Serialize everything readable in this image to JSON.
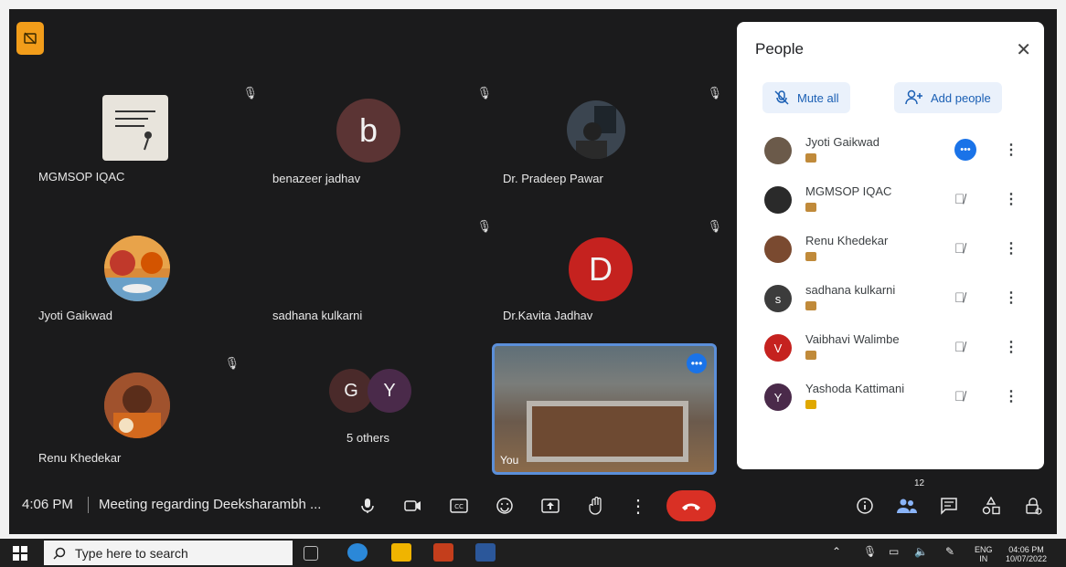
{
  "meeting": {
    "time": "4:06 PM",
    "title": "Meeting regarding Deeksharambh ...",
    "participants_count": "12"
  },
  "tiles": [
    {
      "name": "MGMSOP IQAC"
    },
    {
      "name": "benazeer jadhav",
      "initial": "b"
    },
    {
      "name": "Dr. Pradeep Pawar"
    },
    {
      "name": "Jyoti Gaikwad"
    },
    {
      "name": "sadhana kulkarni"
    },
    {
      "name": "Dr.Kavita Jadhav",
      "initial": "D"
    },
    {
      "name": "Renu Khedekar"
    },
    {
      "name": "5 others",
      "initials": [
        "G",
        "Y"
      ]
    },
    {
      "name": "You"
    }
  ],
  "people_panel": {
    "title": "People",
    "mute_all": "Mute all",
    "add_people": "Add people",
    "people": [
      {
        "name": "Jyoti Gaikwad",
        "avatar_color": "#6b5a4a",
        "state": "speaking"
      },
      {
        "name": "MGMSOP IQAC",
        "avatar_color": "#2a2a2a",
        "state": "muted"
      },
      {
        "name": "Renu Khedekar",
        "avatar_color": "#7a4a30",
        "state": "muted"
      },
      {
        "name": "sadhana kulkarni",
        "initial": "s",
        "avatar_color": "#3c3c3c",
        "state": "muted"
      },
      {
        "name": "Vaibhavi Walimbe",
        "initial": "V",
        "avatar_color": "#c5221f",
        "state": "muted"
      },
      {
        "name": "Yashoda Kattimani",
        "initial": "Y",
        "avatar_color": "#4a2a4a",
        "state": "muted"
      }
    ]
  },
  "taskbar": {
    "search_placeholder": "Type here to search",
    "lang": "ENG",
    "lang2": "IN",
    "time": "04:06 PM",
    "date": "10/07/2022"
  },
  "colors": {
    "accent": "#1a73e8",
    "end_call": "#d93025",
    "meet_bg": "#1b1b1c"
  }
}
